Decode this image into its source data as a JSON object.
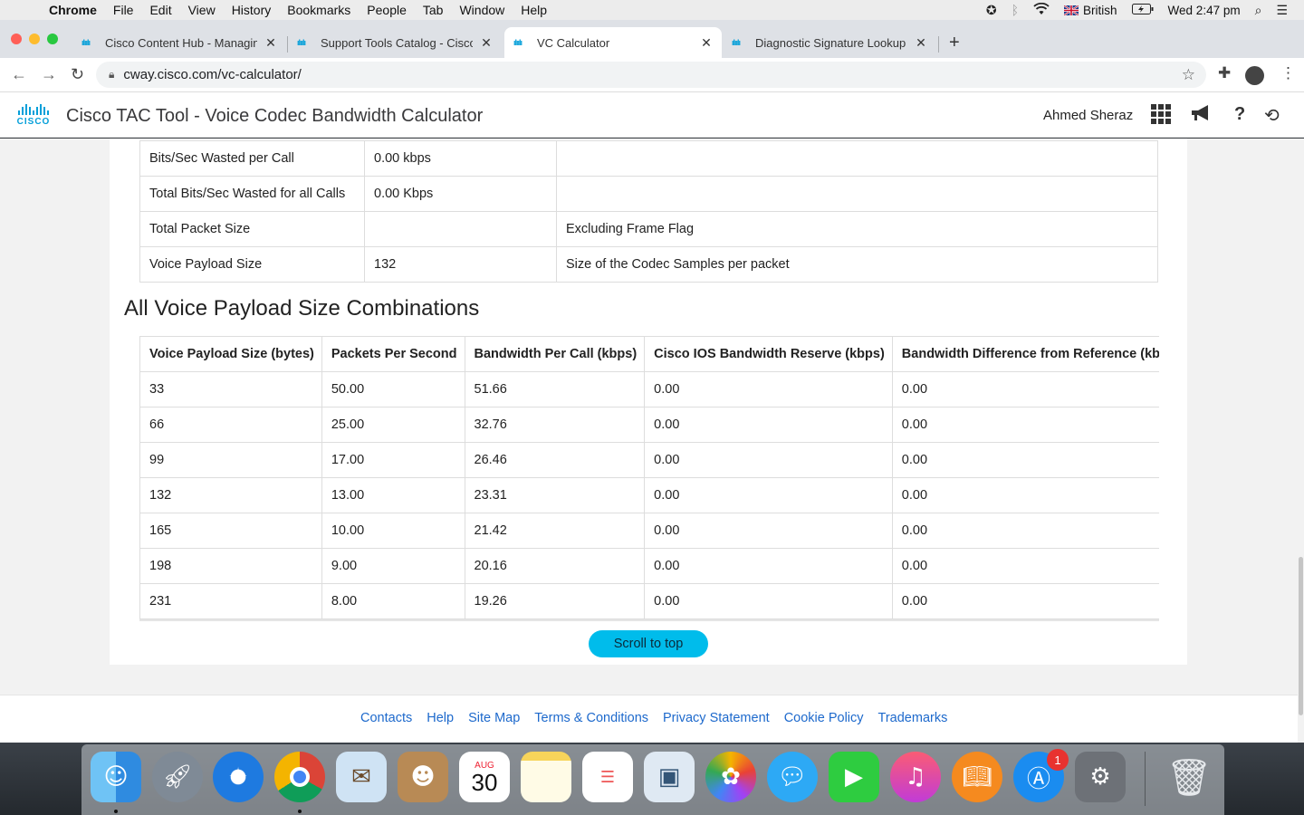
{
  "menubar": {
    "app": "Chrome",
    "items": [
      "File",
      "Edit",
      "View",
      "History",
      "Bookmarks",
      "People",
      "Tab",
      "Window",
      "Help"
    ],
    "input_source": "British",
    "clock": "Wed 2:47 pm"
  },
  "browser": {
    "tabs": [
      {
        "label": "Cisco Content Hub - Managing",
        "fav": "ılıılı"
      },
      {
        "label": "Support Tools Catalog - Cisco",
        "fav": "ılıılı"
      },
      {
        "label": "VC Calculator",
        "fav": "ılıılı"
      },
      {
        "label": "Diagnostic Signature Lookup T",
        "fav": "ılıılı"
      }
    ],
    "url": "cway.cisco.com/vc-calculator/"
  },
  "header": {
    "logo_text": "CISCO",
    "title": "Cisco TAC Tool - Voice Codec Bandwidth Calculator",
    "user": "Ahmed Sheraz"
  },
  "summary_table": {
    "rows": [
      {
        "label": "Bits/Sec Wasted per Call",
        "value": "0.00 kbps",
        "note": ""
      },
      {
        "label": "Total Bits/Sec Wasted for all Calls",
        "value": "0.00 Kbps",
        "note": ""
      },
      {
        "label": "Total Packet Size",
        "value": "",
        "note": "Excluding Frame Flag"
      },
      {
        "label": "Voice Payload Size",
        "value": "132",
        "note": "Size of the Codec Samples per packet"
      }
    ]
  },
  "combinations": {
    "title": "All Voice Payload Size Combinations",
    "headers": [
      "Voice Payload Size (bytes)",
      "Packets Per Second",
      "Bandwidth Per Call (kbps)",
      "Cisco IOS Bandwidth Reserve (kbps)",
      "Bandwidth Difference from Reference (kbps)"
    ],
    "rows": [
      [
        "33",
        "50.00",
        "51.66",
        "0.00",
        "0.00"
      ],
      [
        "66",
        "25.00",
        "32.76",
        "0.00",
        "0.00"
      ],
      [
        "99",
        "17.00",
        "26.46",
        "0.00",
        "0.00"
      ],
      [
        "132",
        "13.00",
        "23.31",
        "0.00",
        "0.00"
      ],
      [
        "165",
        "10.00",
        "21.42",
        "0.00",
        "0.00"
      ],
      [
        "198",
        "9.00",
        "20.16",
        "0.00",
        "0.00"
      ],
      [
        "231",
        "8.00",
        "19.26",
        "0.00",
        "0.00"
      ]
    ]
  },
  "scroll_top_label": "Scroll to top",
  "footer": {
    "links": [
      "Contacts",
      "Help",
      "Site Map",
      "Terms & Conditions",
      "Privacy Statement",
      "Cookie Policy",
      "Trademarks"
    ]
  },
  "dock": {
    "calendar_month": "AUG",
    "calendar_day": "30",
    "appstore_badge": "1",
    "icons": [
      "finder-icon",
      "launchpad-icon",
      "safari-icon",
      "chrome-icon",
      "mail-icon",
      "contacts-icon",
      "calendar-icon",
      "notes-icon",
      "reminders-icon",
      "preview-icon",
      "photos-icon",
      "messages-icon",
      "facetime-icon",
      "music-icon",
      "books-icon",
      "app-store-icon",
      "system-preferences-icon",
      "trash-icon"
    ]
  }
}
